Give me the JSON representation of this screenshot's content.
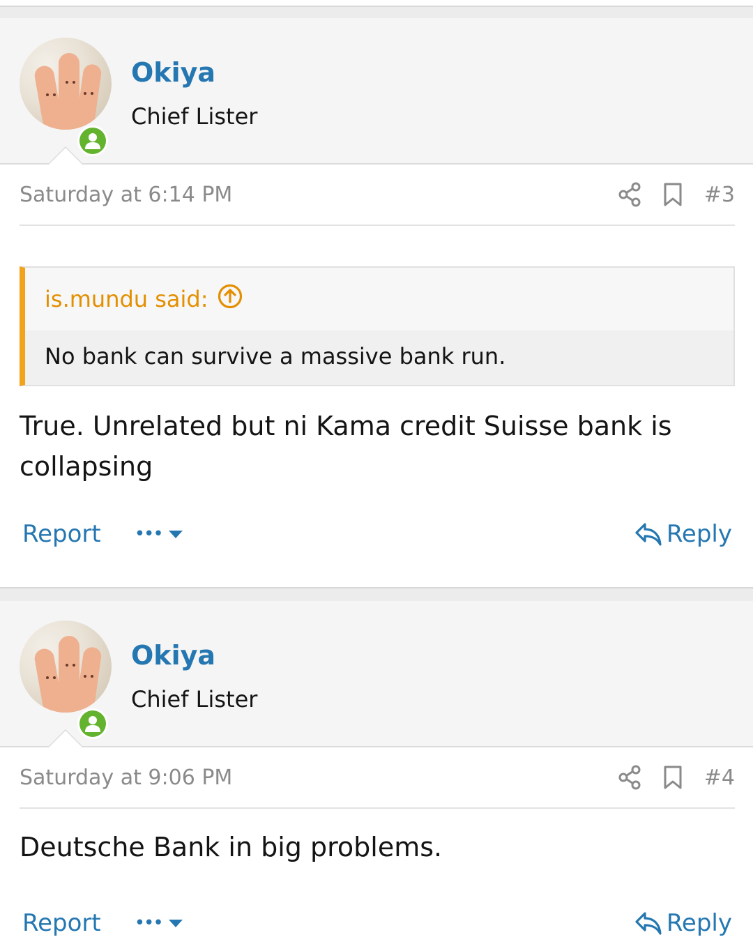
{
  "posts": [
    {
      "username": "Okiya",
      "user_title": "Chief Lister",
      "date": "Saturday at 6:14 PM",
      "post_number": "#3",
      "quote": {
        "author": "is.mundu said:",
        "text": "No bank can survive a massive bank run."
      },
      "message": "True. Unrelated but ni Kama credit Suisse bank is collapsing",
      "report_label": "Report",
      "more_label": "•••",
      "reply_label": "Reply"
    },
    {
      "username": "Okiya",
      "user_title": "Chief Lister",
      "date": "Saturday at 9:06 PM",
      "post_number": "#4",
      "message": "Deutsche Bank in big problems.",
      "report_label": "Report",
      "more_label": "•••",
      "reply_label": "Reply"
    }
  ],
  "icons": {
    "share": "share-icon",
    "bookmark": "bookmark-icon",
    "reply": "reply-arrow-icon",
    "quote_jump": "arrow-up-circle-icon",
    "online": "online-status-icon",
    "more_caret": "caret-down-icon"
  },
  "colors": {
    "link": "#2577b1",
    "quote_accent": "#f2a21b",
    "quote_author": "#e38f00",
    "online": "#63b32e",
    "muted": "#8a8a8a"
  }
}
